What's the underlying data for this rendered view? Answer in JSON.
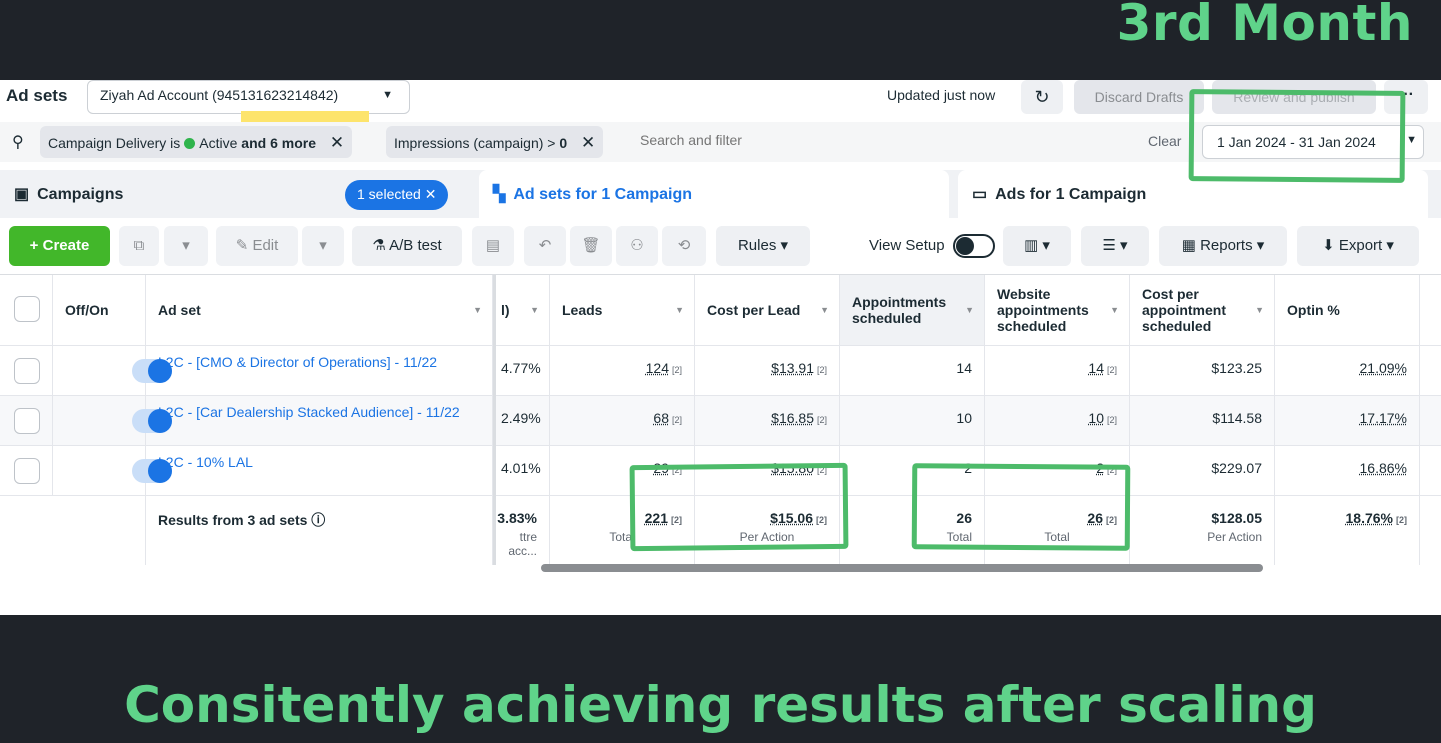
{
  "headline_top": "3rd Month",
  "headline_bottom": "Consitently achieving results after scaling",
  "topbar": {
    "title": "Ad sets",
    "account": "Ziyah Ad Account (945131623214842)",
    "updated": "Updated just now",
    "discard": "Discard Drafts",
    "review": "Review and publish",
    "more": "···"
  },
  "filter": {
    "chip1_prefix": "Campaign Delivery is",
    "chip1_active": "Active",
    "chip1_more": "and 6 more",
    "chip2_prefix": "Impressions (campaign) >",
    "chip2_value": "0",
    "search_placeholder": "Search and filter",
    "clear": "Clear",
    "date_range": "1 Jan 2024 - 31 Jan 2024"
  },
  "tabs": {
    "campaigns": "Campaigns",
    "selected": "1 selected",
    "adsets": "Ad sets for 1 Campaign",
    "ads": "Ads for 1 Campaign"
  },
  "toolbar": {
    "create": "Create",
    "edit": "Edit",
    "ab_test": "A/B test",
    "rules": "Rules",
    "view_setup": "View Setup",
    "reports": "Reports",
    "export": "Export"
  },
  "table": {
    "headers": {
      "offon": "Off/On",
      "adset": "Ad set",
      "partial": "l)",
      "leads": "Leads",
      "cpl": "Cost per Lead",
      "appts": "Appointments scheduled",
      "web_appts": "Website appointments scheduled",
      "cost_appt": "Cost per appointment scheduled",
      "optin": "Optin %"
    },
    "rows": [
      {
        "name": "L2C - [CMO & Director of Operations] - 11/22",
        "partial": "4.77%",
        "leads": "124",
        "cpl": "$13.91",
        "appts": "14",
        "web_appts": "14",
        "cost_appt": "$123.25",
        "optin": "21.09%"
      },
      {
        "name": "L2C - [Car Dealership Stacked Audience] - 11/22",
        "partial": "2.49%",
        "leads": "68",
        "cpl": "$16.85",
        "appts": "10",
        "web_appts": "10",
        "cost_appt": "$114.58",
        "optin": "17.17%"
      },
      {
        "name": "L2C - 10% LAL",
        "partial": "4.01%",
        "leads": "29",
        "cpl": "$15.80",
        "appts": "2",
        "web_appts": "2",
        "cost_appt": "$229.07",
        "optin": "16.86%"
      }
    ],
    "ref": "[2]",
    "totals": {
      "label": "Results from 3 ad sets",
      "partial": "3.83%",
      "partial_sub": "ttre acc...",
      "leads": "221",
      "leads_sub": "Total",
      "cpl": "$15.06",
      "cpl_sub": "Per Action",
      "appts": "26",
      "appts_sub": "Total",
      "web_appts": "26",
      "web_appts_sub": "Total",
      "cost_appt": "$128.05",
      "cost_appt_sub": "Per Action",
      "optin": "18.76%"
    }
  },
  "colors": {
    "accent_green": "#5fd38a",
    "brand_blue": "#1b74e4",
    "create_green": "#42b72a"
  }
}
